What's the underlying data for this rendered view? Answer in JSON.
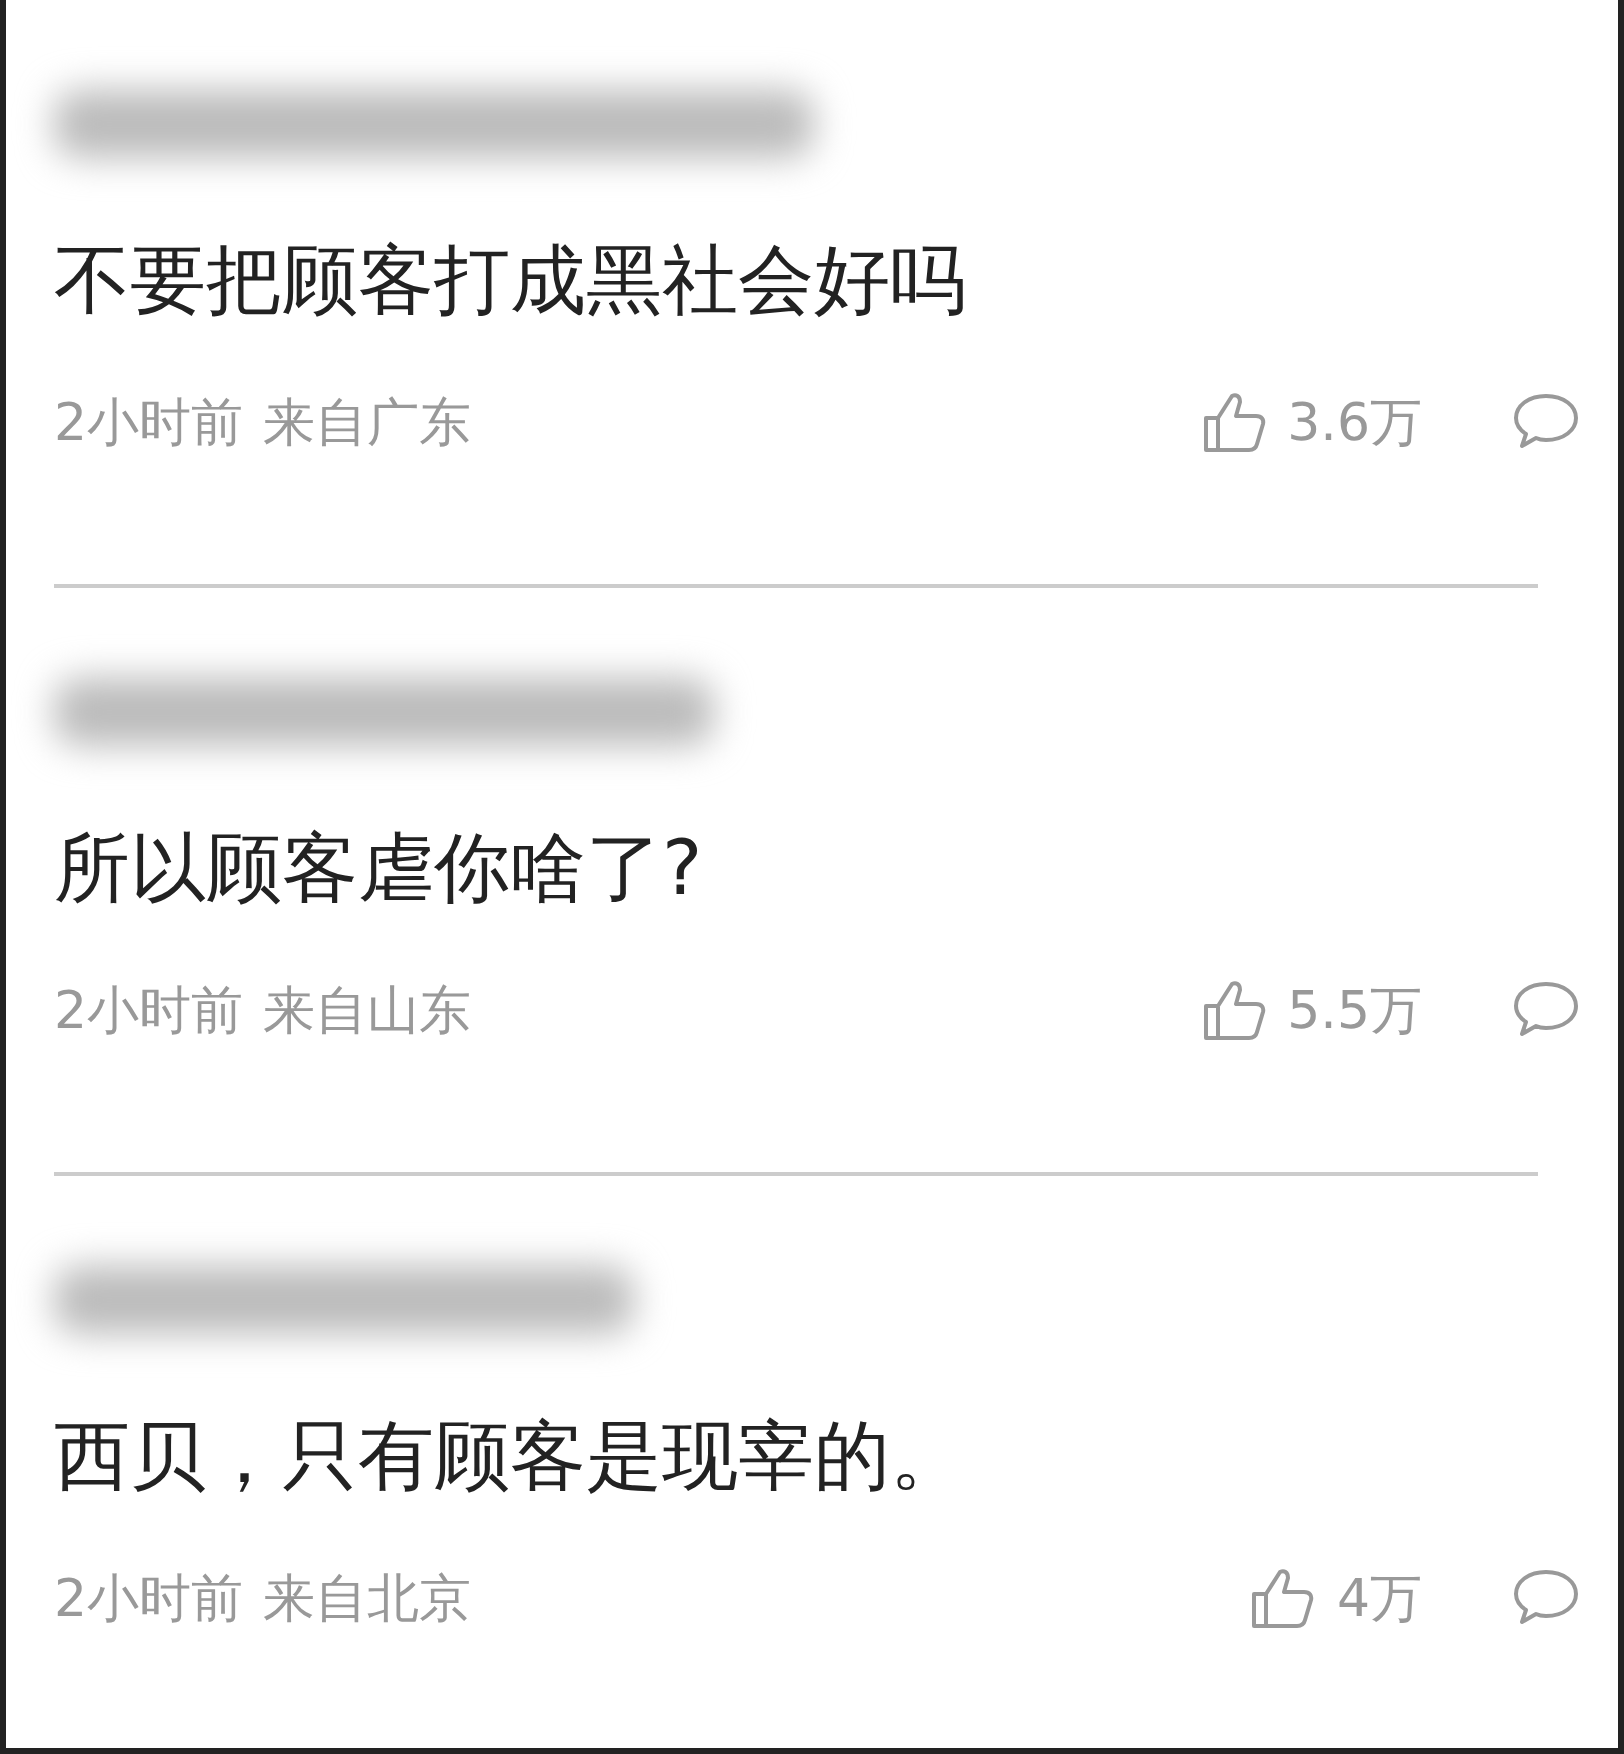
{
  "comments": [
    {
      "author_blurred": true,
      "text": "不要把顾客打成黑社会好吗",
      "time": "2小时前",
      "location": "来自广东",
      "likes": "3.6万"
    },
    {
      "author_blurred": true,
      "text": "所以顾客虐你啥了?",
      "time": "2小时前",
      "location": "来自山东",
      "likes": "5.5万"
    },
    {
      "author_blurred": true,
      "text": "西贝，只有顾客是现宰的。",
      "time": "2小时前",
      "location": "来自北京",
      "likes": "4万"
    }
  ]
}
